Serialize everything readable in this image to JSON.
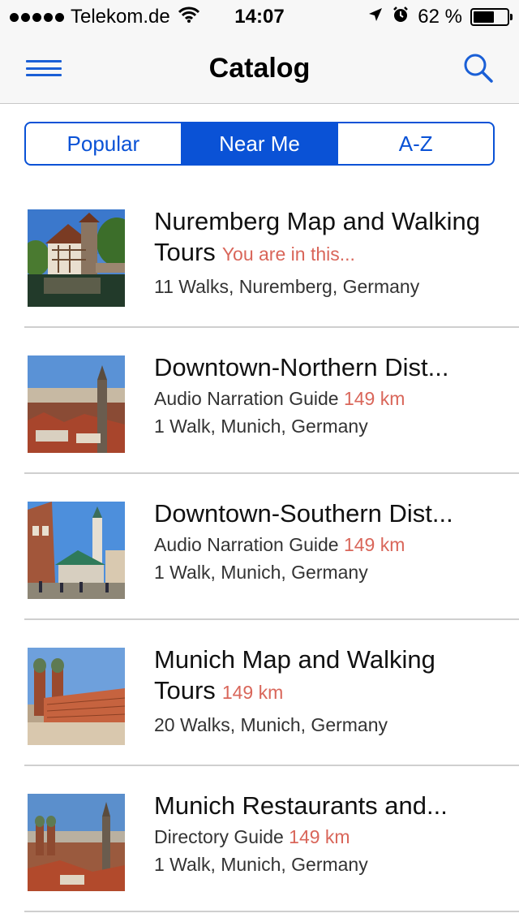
{
  "status": {
    "carrier": "Telekom.de",
    "time": "14:07",
    "battery": "62 %",
    "battery_level": 0.62
  },
  "nav": {
    "title": "Catalog"
  },
  "tabs": [
    {
      "label": "Popular",
      "active": false
    },
    {
      "label": "Near Me",
      "active": true
    },
    {
      "label": "A-Z",
      "active": false
    }
  ],
  "items": [
    {
      "title": "Nuremberg Map and Walking Tours",
      "badge": "You are in this...",
      "subtitle": "",
      "distance": "",
      "details": "11 Walks, Nuremberg, Germany"
    },
    {
      "title": "Downtown-Northern Dist...",
      "badge": "",
      "subtitle": "Audio Narration Guide",
      "distance": "149 km",
      "details": "1 Walk, Munich, Germany"
    },
    {
      "title": "Downtown-Southern Dist...",
      "badge": "",
      "subtitle": "Audio Narration Guide",
      "distance": "149 km",
      "details": "1 Walk, Munich, Germany"
    },
    {
      "title": "Munich Map and Walking Tours",
      "badge": "149 km",
      "subtitle": "",
      "distance": "",
      "details": "20 Walks, Munich, Germany"
    },
    {
      "title": "Munich Restaurants and...",
      "badge": "",
      "subtitle": "Directory Guide",
      "distance": "149 km",
      "details": "1 Walk, Munich, Germany"
    }
  ],
  "colors": {
    "accent": "#0a52d6",
    "distance": "#d9665a"
  }
}
